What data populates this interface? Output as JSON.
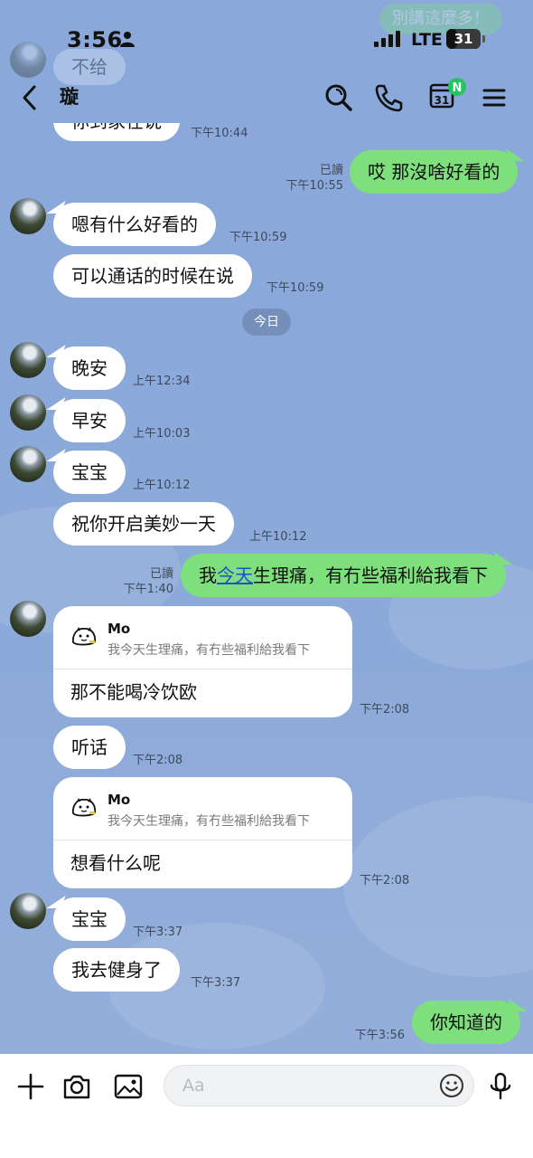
{
  "status_bar": {
    "time": "3:56",
    "network": "LTE",
    "battery_level": "31",
    "battery_fraction": 0.31
  },
  "header": {
    "contact_name": "璇",
    "calendar_day": "31",
    "calendar_badge": "N"
  },
  "faded_top": {
    "outgoing_text": "別講這麼多！",
    "incoming_a": "不给",
    "incoming_b": "你到家在说"
  },
  "messages": [
    {
      "type": "incoming-continued",
      "text": "你到家在说",
      "time": "下午10:44"
    },
    {
      "type": "outgoing",
      "text": "哎 那沒啥好看的",
      "read": "已讀",
      "time": "下午10:55"
    },
    {
      "type": "incoming",
      "text": "嗯有什么好看的",
      "time": "下午10:59"
    },
    {
      "type": "incoming-continued",
      "text": "可以通话的时候在说",
      "time": "下午10:59"
    },
    {
      "type": "date",
      "text": "今日"
    },
    {
      "type": "incoming",
      "text": "晚安",
      "time": "上午12:34"
    },
    {
      "type": "incoming",
      "text": "早安",
      "time": "上午10:03"
    },
    {
      "type": "incoming",
      "text": "宝宝",
      "time": "上午10:12"
    },
    {
      "type": "incoming-continued",
      "text": "祝你开启美妙一天",
      "time": "上午10:12"
    },
    {
      "type": "outgoing",
      "text_before": "我",
      "text_link": "今天",
      "text_after": "生理痛，有冇些福利給我看下",
      "read": "已讀",
      "time": "下午1:40"
    },
    {
      "type": "reply",
      "quote_name": "Mo",
      "quote_text": "我今天生理痛，有冇些福利給我看下",
      "text": "那不能喝冷饮欧",
      "time": "下午2:08"
    },
    {
      "type": "incoming-continued",
      "text": "听话",
      "time": "下午2:08"
    },
    {
      "type": "reply",
      "quote_name": "Mo",
      "quote_text": "我今天生理痛，有冇些福利給我看下",
      "text": "想看什么呢",
      "time": "下午2:08"
    },
    {
      "type": "incoming",
      "text": "宝宝",
      "time": "下午3:37"
    },
    {
      "type": "incoming-continued",
      "text": "我去健身了",
      "time": "下午3:37"
    },
    {
      "type": "outgoing",
      "text": "你知道的",
      "time": "下午3:56"
    }
  ],
  "input_bar": {
    "placeholder": "Aa"
  },
  "colors": {
    "chat_background": "#8DAAD8",
    "outgoing_bubble": "#7EE07C",
    "incoming_bubble": "#FFFFFF",
    "badge_green": "#22C55E"
  },
  "icons": [
    "back-icon",
    "search-icon",
    "phone-icon",
    "calendar-icon",
    "menu-icon",
    "plus-icon",
    "camera-icon",
    "image-icon",
    "emoji-icon",
    "microphone-icon"
  ]
}
